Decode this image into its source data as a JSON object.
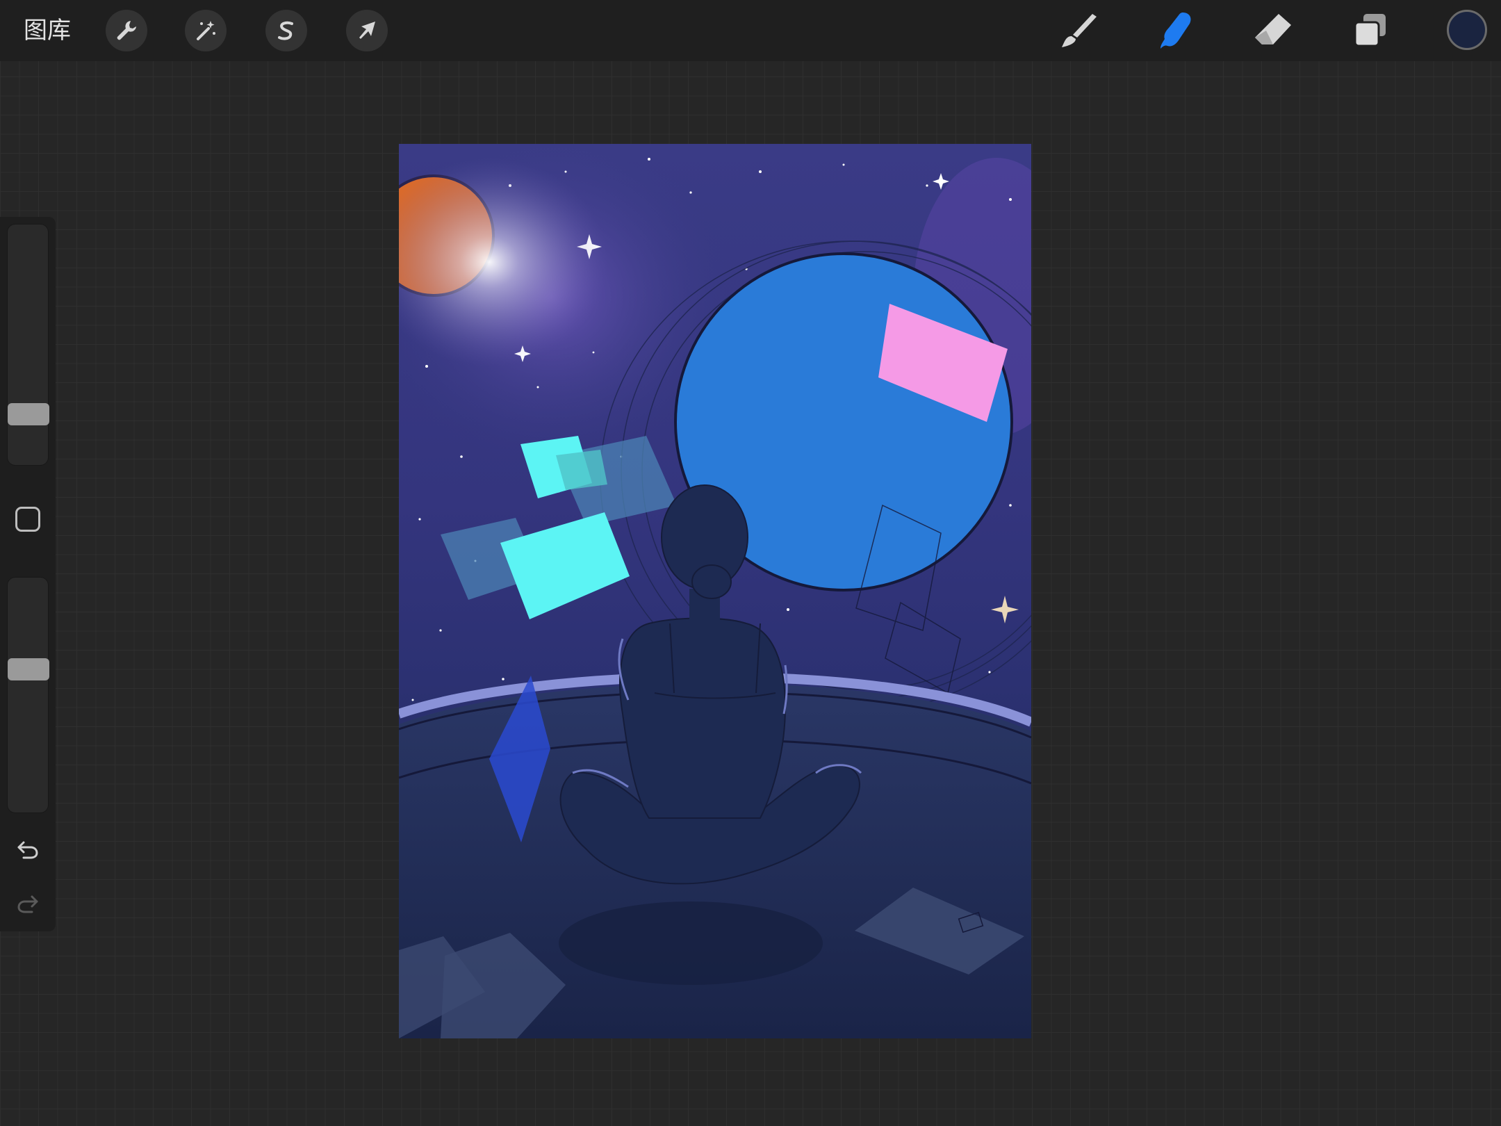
{
  "topbar": {
    "gallery_label": "图库",
    "left_tools": [
      {
        "name": "actions",
        "icon": "wrench-icon"
      },
      {
        "name": "adjustments",
        "icon": "magic-wand-icon"
      },
      {
        "name": "selection",
        "icon": "selection-s-icon"
      },
      {
        "name": "transform",
        "icon": "arrow-cursor-icon"
      }
    ],
    "right_tools": [
      {
        "name": "brush",
        "icon": "brush-icon",
        "active": false
      },
      {
        "name": "smudge",
        "icon": "smudge-finger-icon",
        "active": true
      },
      {
        "name": "eraser",
        "icon": "eraser-icon",
        "active": false
      },
      {
        "name": "layers",
        "icon": "layers-icon",
        "active": false
      }
    ],
    "current_color": "#1a2440"
  },
  "sidebar": {
    "brush_size": 0.18,
    "opacity": 0.62,
    "modify_icon": "square-icon",
    "undo_icon": "undo-arrow-icon",
    "redo_icon": "redo-arrow-icon"
  },
  "colors": {
    "accent": "#1e7bf0",
    "planet_blue": "#2a7bd8",
    "planet_orange": "#d96a2c",
    "cyan": "#5cf4f4",
    "pink": "#f59ae6"
  }
}
